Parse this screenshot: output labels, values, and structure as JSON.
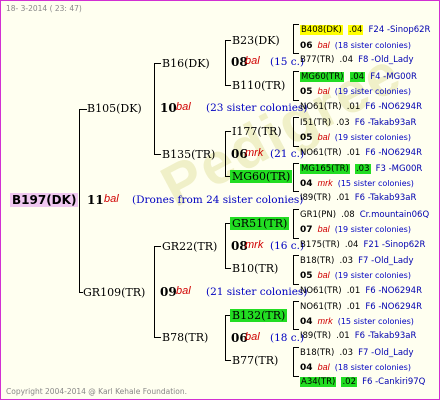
{
  "header": {
    "date": "18- 3-2014 ( 23: 47)"
  },
  "footer": {
    "copyright": "Copyright 2004-2014 @ Karl Kehale Foundation."
  },
  "watermark": "Pedigree",
  "root": {
    "name": "B197(DK)",
    "num": "11",
    "breeder": "bal",
    "note": "(Drones from 24 sister colonies)"
  },
  "gen1": [
    {
      "name": "B105(DK)",
      "num": "10",
      "breeder": "bal",
      "sisters": "(23 sister colonies)"
    },
    {
      "name": "GR109(TR)",
      "num": "09",
      "breeder": "bal",
      "sisters": "(21 sister colonies)"
    }
  ],
  "gen2": [
    {
      "name": "B16(DK)",
      "num": "08",
      "breeder": "bal",
      "sisters": "(15 c.)"
    },
    {
      "name": "B135(TR)",
      "num": "06",
      "breeder": "mrk",
      "sisters": "(21 c.)"
    },
    {
      "name": "GR22(TR)",
      "num": "08",
      "breeder": "mrk",
      "sisters": "(16 c.)"
    },
    {
      "name": "B78(TR)",
      "num": "06",
      "breeder": "bal",
      "sisters": "(18 c.)"
    }
  ],
  "gen3": [
    {
      "name": "B23(DK)"
    },
    {
      "name": "B110(TR)"
    },
    {
      "name": "I177(TR)"
    },
    {
      "name": "MG60(TR)"
    },
    {
      "name": "GR51(TR)"
    },
    {
      "name": "B10(TR)"
    },
    {
      "name": "B132(TR)"
    },
    {
      "name": "B77(TR)"
    }
  ],
  "gen4": [
    {
      "name": "B408(DK)",
      "val": ".04",
      "anc": "F24 -Sinop62R"
    },
    {
      "num": "06",
      "breeder": "bal",
      "sisters": "(18 sister colonies)"
    },
    {
      "name": "B77(TR)",
      "val": ".04",
      "anc": "F8 -Old_Lady"
    },
    {
      "name": "MG60(TR)",
      "val": ".04",
      "anc": "F4 -MG00R"
    },
    {
      "num": "05",
      "breeder": "bal",
      "sisters": "(19 sister colonies)"
    },
    {
      "name": "NO61(TR)",
      "val": ".01",
      "anc": "F6 -NO6294R"
    },
    {
      "name": "I51(TR)",
      "val": ".03",
      "anc": "F6 -Takab93aR"
    },
    {
      "num": "05",
      "breeder": "bal",
      "sisters": "(19 sister colonies)"
    },
    {
      "name": "NO61(TR)",
      "val": ".01",
      "anc": "F6 -NO6294R"
    },
    {
      "name": "MG165(TR)",
      "val": ".03",
      "anc": "F3 -MG00R"
    },
    {
      "num": "04",
      "breeder": "mrk",
      "sisters": "(15 sister colonies)"
    },
    {
      "name": "I89(TR)",
      "val": ".01",
      "anc": "F6 -Takab93aR"
    },
    {
      "name": "GR1(PN)",
      "val": ".08",
      "anc": "Cr.mountain06Q"
    },
    {
      "num": "07",
      "breeder": "bal",
      "sisters": "(19 sister colonies)"
    },
    {
      "name": "B175(TR)",
      "val": ".04",
      "anc": "F21 -Sinop62R"
    },
    {
      "name": "B18(TR)",
      "val": ".03",
      "anc": "F7 -Old_Lady"
    },
    {
      "num": "05",
      "breeder": "bal",
      "sisters": "(19 sister colonies)"
    },
    {
      "name": "NO61(TR)",
      "val": ".01",
      "anc": "F6 -NO6294R"
    },
    {
      "name": "NO61(TR)",
      "val": ".01",
      "anc": "F6 -NO6294R"
    },
    {
      "num": "04",
      "breeder": "mrk",
      "sisters": "(15 sister colonies)"
    },
    {
      "name": "I89(TR)",
      "val": ".01",
      "anc": "F6 -Takab93aR"
    },
    {
      "name": "B18(TR)",
      "val": ".03",
      "anc": "F7 -Old_Lady"
    },
    {
      "num": "04",
      "breeder": "bal",
      "sisters": "(18 sister colonies)"
    },
    {
      "name": "A34(TR)",
      "val": ".02",
      "anc": "F6 -Cankiri97Q"
    }
  ]
}
